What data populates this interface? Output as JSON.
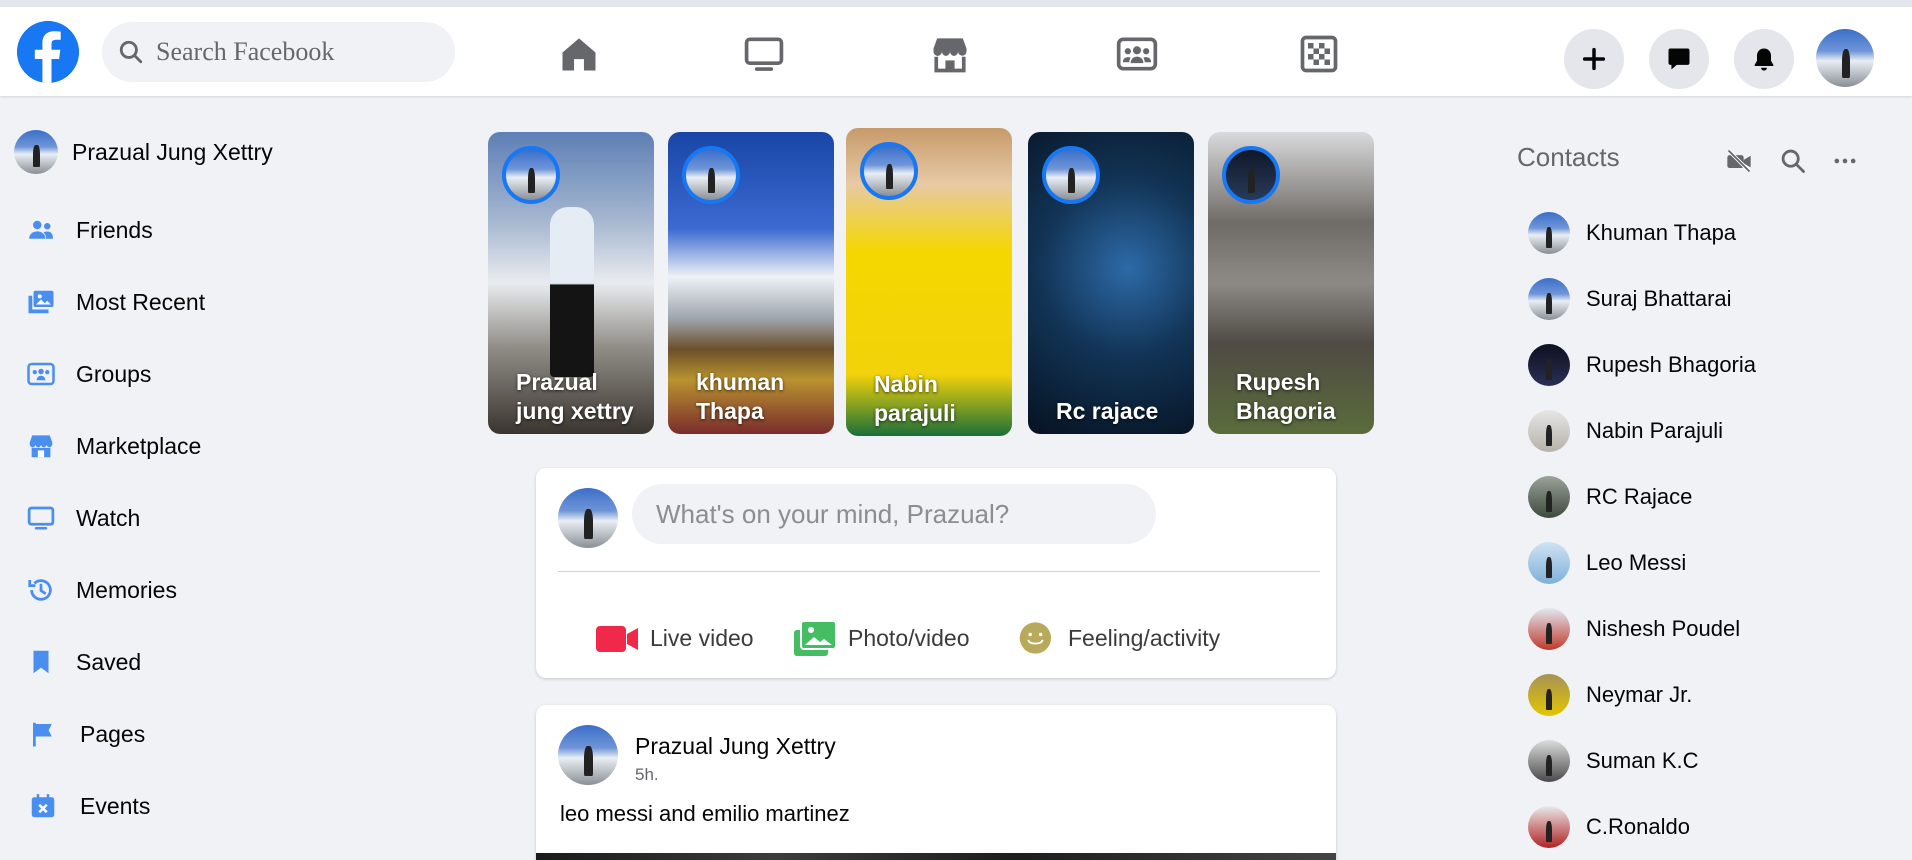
{
  "search": {
    "placeholder": "Search Facebook"
  },
  "nav": {
    "icons": [
      "home-icon",
      "watch-icon",
      "marketplace-icon",
      "groups-icon",
      "gaming-icon"
    ]
  },
  "header_actions": {
    "icons": [
      "plus-icon",
      "messenger-icon",
      "bell-icon"
    ]
  },
  "sidebar": {
    "profile_name": "Prazual Jung Xettry",
    "items": [
      {
        "label": "Friends",
        "icon": "friends-icon"
      },
      {
        "label": "Most Recent",
        "icon": "most-recent-icon"
      },
      {
        "label": "Groups",
        "icon": "groups-icon"
      },
      {
        "label": "Marketplace",
        "icon": "marketplace-icon"
      },
      {
        "label": "Watch",
        "icon": "watch-icon"
      },
      {
        "label": "Memories",
        "icon": "memories-icon"
      },
      {
        "label": "Saved",
        "icon": "saved-icon"
      },
      {
        "label": "Pages",
        "icon": "flag-icon"
      },
      {
        "label": "Events",
        "icon": "calendar-icon"
      }
    ]
  },
  "stories": [
    {
      "name": "Prazual jung xettry"
    },
    {
      "name": "khuman Thapa"
    },
    {
      "name": "Nabin parajuli"
    },
    {
      "name": "Rc rajace"
    },
    {
      "name": "Rupesh Bhagoria"
    }
  ],
  "composer": {
    "placeholder": "What's on your mind, Prazual?",
    "actions": [
      {
        "label": "Live video",
        "icon": "live-video-icon",
        "color": "#f02849"
      },
      {
        "label": "Photo/video",
        "icon": "photo-video-icon",
        "color": "#45bd62"
      },
      {
        "label": "Feeling/activity",
        "icon": "feeling-icon",
        "color": "#b9a95a"
      }
    ]
  },
  "post": {
    "author": "Prazual Jung Xettry",
    "time": "5h.",
    "text": "leo messi and emilio martinez"
  },
  "contacts": {
    "title": "Contacts",
    "list": [
      {
        "name": "Khuman Thapa"
      },
      {
        "name": "Suraj Bhattarai"
      },
      {
        "name": "Rupesh Bhagoria"
      },
      {
        "name": "Nabin Parajuli"
      },
      {
        "name": "RC Rajace"
      },
      {
        "name": "Leo Messi"
      },
      {
        "name": "Nishesh Poudel"
      },
      {
        "name": "Neymar Jr."
      },
      {
        "name": "Suman K.C"
      },
      {
        "name": "C.Ronaldo"
      }
    ]
  },
  "colors": {
    "brand": "#1877f2",
    "nav_icon": "#65676b",
    "background": "#f0f2f5"
  }
}
